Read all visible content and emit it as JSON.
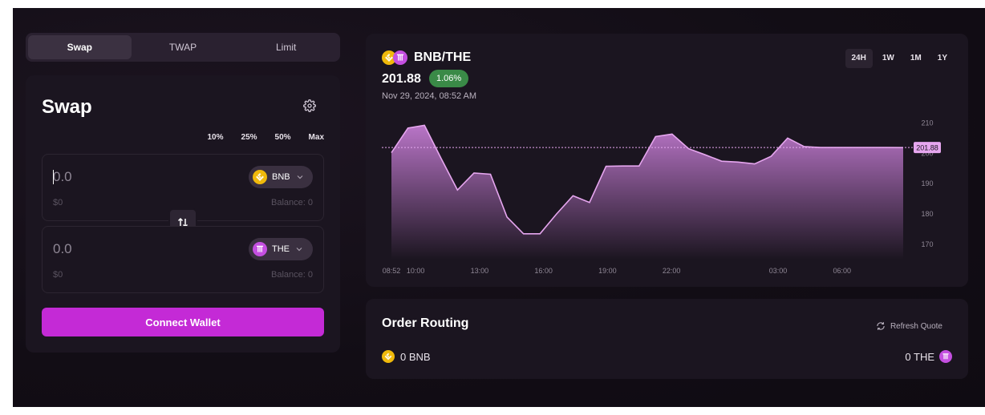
{
  "tabs": [
    {
      "label": "Swap",
      "active": true
    },
    {
      "label": "TWAP",
      "active": false
    },
    {
      "label": "Limit",
      "active": false
    }
  ],
  "swap": {
    "title": "Swap",
    "settings_icon": "gear-icon",
    "percent_buttons": [
      "10%",
      "25%",
      "50%",
      "Max"
    ],
    "from": {
      "amount_placeholder": "0.0",
      "usd": "$0",
      "balance": "Balance: 0",
      "token": "BNB"
    },
    "to": {
      "amount_placeholder": "0.0",
      "usd": "$0",
      "balance": "Balance: 0",
      "token": "THE"
    },
    "switch_icon": "swap-arrows-icon",
    "connect_label": "Connect Wallet"
  },
  "chart_panel": {
    "pair": "BNB/THE",
    "price": "201.88",
    "change": "1.06%",
    "date": "Nov 29, 2024, 08:52 AM",
    "ranges": [
      {
        "label": "24H",
        "active": true
      },
      {
        "label": "1W",
        "active": false
      },
      {
        "label": "1M",
        "active": false
      },
      {
        "label": "1Y",
        "active": false
      }
    ]
  },
  "chart_data": {
    "type": "area",
    "x": [
      "08:52",
      "09:30",
      "10:00",
      "10:50",
      "11:40",
      "12:30",
      "13:00",
      "13:40",
      "14:30",
      "15:20",
      "16:00",
      "16:40",
      "17:30",
      "18:20",
      "19:00",
      "19:40",
      "20:30",
      "21:20",
      "22:00",
      "22:40",
      "23:30",
      "00:20",
      "01:10",
      "02:00",
      "02:40",
      "03:30",
      "04:20",
      "05:10",
      "06:00",
      "06:50",
      "07:40",
      "08:52"
    ],
    "values": [
      200.2,
      208.3,
      209.2,
      198.4,
      187.9,
      193.5,
      193.1,
      179.0,
      173.5,
      173.5,
      180.0,
      186.0,
      183.8,
      195.7,
      195.8,
      195.8,
      205.5,
      206.3,
      201.5,
      199.5,
      197.4,
      197.1,
      196.5,
      199.0,
      205.0,
      202.2,
      201.9,
      201.9,
      201.9,
      201.9,
      201.9,
      201.88
    ],
    "x_ticks": [
      "10:00",
      "13:00",
      "16:00",
      "19:00",
      "22:00",
      "03:00",
      "06:00",
      "08:52"
    ],
    "y_ticks": [
      210,
      200,
      190,
      180,
      170
    ],
    "ylim": [
      165,
      213
    ],
    "current_value_label": "201.88",
    "line_color": "#e6a6ef",
    "fill_color_top": "#b975c7",
    "fill_color_bottom": "#1b1520",
    "grid": false
  },
  "routing": {
    "title": "Order Routing",
    "refresh_label": "Refresh Quote",
    "from_text": "0 BNB",
    "to_text": "0 THE"
  },
  "colors": {
    "accent": "#c42ad6",
    "bnb": "#f0b90b",
    "the": "#c44fe0",
    "positive": "#3a8a47"
  }
}
